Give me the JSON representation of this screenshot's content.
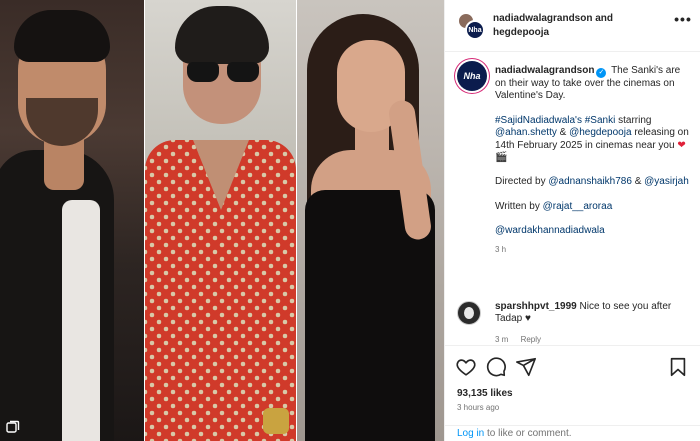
{
  "header": {
    "names": "nadiadwalagrandson and hegdepooja",
    "avatar_text": "Nha",
    "more": "•••"
  },
  "post": {
    "avatar_text": "Nha",
    "username": "nadiadwalagrandson",
    "verified_mark": "✓",
    "caption_text": "The Sanki's are on their way to take over the cinemas on Valentine's Day.",
    "para2": {
      "tag1": "#SajidNadiadwala's",
      "tag2": "#Sanki",
      "word_starring": "starring",
      "mention1": "@ahan.shetty",
      "amp": "&",
      "mention2": "@hegdepooja",
      "rest": "releasing on 14th February 2025 in cinemas near you",
      "emoji_heart": "❤",
      "emoji_clapper": "🎬"
    },
    "para3": {
      "directed_by": "Directed by",
      "mention1": "@adnanshaikh786",
      "amp": "&",
      "mention2": "@yasirjah"
    },
    "para4": {
      "written_by": "Written by",
      "mention": "@rajat__aroraa"
    },
    "para5": {
      "mention": "@wardakhannadiadwala"
    },
    "time": "3 h"
  },
  "comment": {
    "username": "sparshhpvt_1999",
    "text": "Nice to see you after Tadap ♥",
    "time": "3 m",
    "reply": "Reply"
  },
  "actions": {
    "icons": [
      "heart-icon",
      "comment-icon",
      "share-icon",
      "bookmark-icon"
    ],
    "likes": "93,135 likes",
    "posted": "3 hours ago"
  },
  "login": {
    "link": "Log in",
    "rest": " to like or comment."
  },
  "colors": {
    "accent": "#0095f6",
    "link": "#00376b",
    "muted": "#737373"
  }
}
